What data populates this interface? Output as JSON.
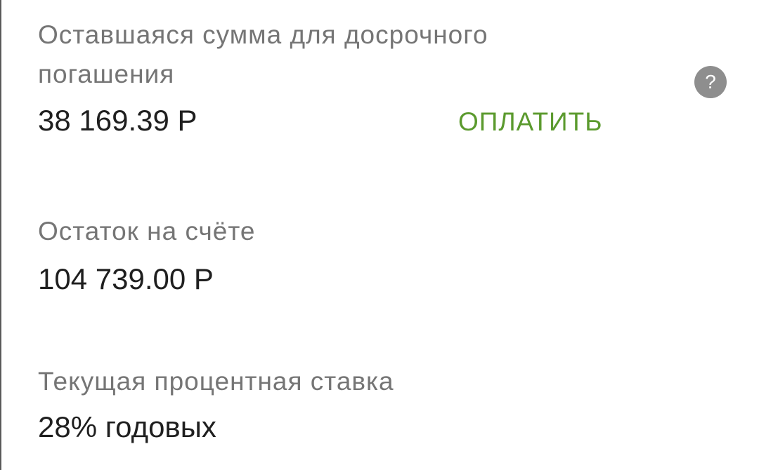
{
  "early_repayment": {
    "label_line1": "Оставшаяся сумма для досрочного",
    "label_line2": "погашения",
    "amount": "38 169.39 Р",
    "pay_label": "ОПЛАТИТЬ",
    "help_icon": "?"
  },
  "account_balance": {
    "label": "Остаток на счёте",
    "amount": "104 739.00 Р"
  },
  "interest_rate": {
    "label": "Текущая процентная ставка",
    "value": "28% годовых"
  },
  "colors": {
    "accent_green": "#5b9a2e",
    "label_gray": "#757575",
    "value_dark": "#1f1f1f",
    "icon_gray": "#8e8e8e"
  }
}
